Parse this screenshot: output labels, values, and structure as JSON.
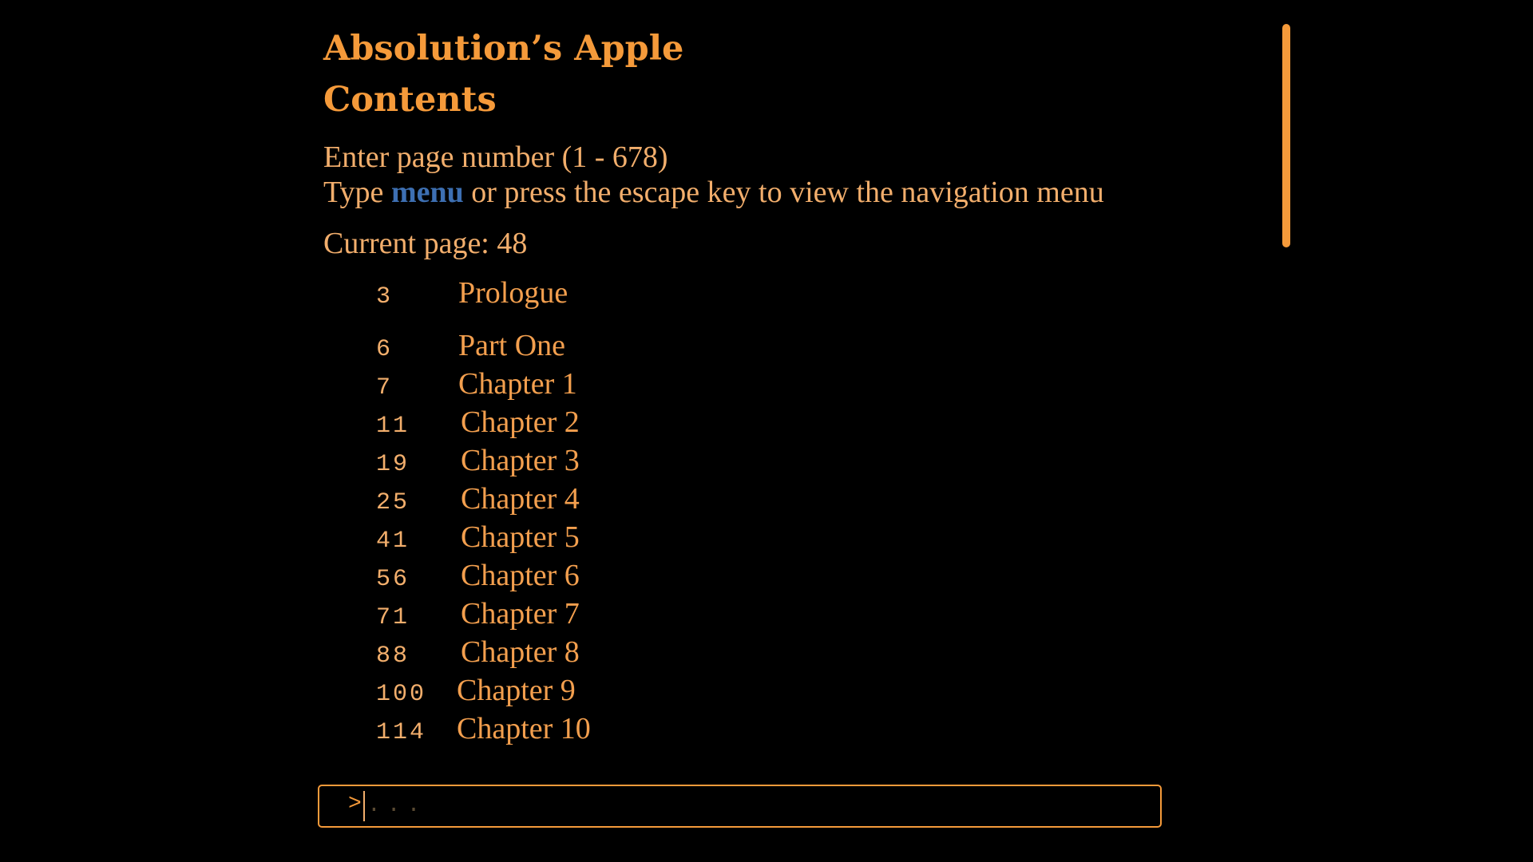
{
  "header": {
    "book_title": "Absolution’s Apple",
    "section_heading": "Contents"
  },
  "instructions": {
    "page_range": "Enter page number (1 - 678)",
    "menu_hint_prefix": "Type ",
    "menu_keyword": "menu",
    "menu_hint_suffix": " or press the escape key to view the navigation menu",
    "current_page_label": "Current page: 48"
  },
  "toc": {
    "entries": [
      {
        "page": "3",
        "title": "Prologue"
      },
      {
        "page": "6",
        "title": "Part One"
      },
      {
        "page": "7",
        "title": "Chapter 1"
      },
      {
        "page": "11",
        "title": "Chapter 2"
      },
      {
        "page": "19",
        "title": "Chapter 3"
      },
      {
        "page": "25",
        "title": "Chapter 4"
      },
      {
        "page": "41",
        "title": "Chapter 5"
      },
      {
        "page": "56",
        "title": "Chapter 6"
      },
      {
        "page": "71",
        "title": "Chapter 7"
      },
      {
        "page": "88",
        "title": "Chapter 8"
      },
      {
        "page": "100",
        "title": "Chapter 9"
      },
      {
        "page": "114",
        "title": "Chapter 10"
      }
    ]
  },
  "command_input": {
    "prompt": ">",
    "value": "",
    "placeholder": "..."
  },
  "colors": {
    "background": "#000000",
    "heading": "#f59a3a",
    "body_text": "#f2ae6c",
    "keyword": "#3d6fb2",
    "accent": "#f59a3a"
  }
}
